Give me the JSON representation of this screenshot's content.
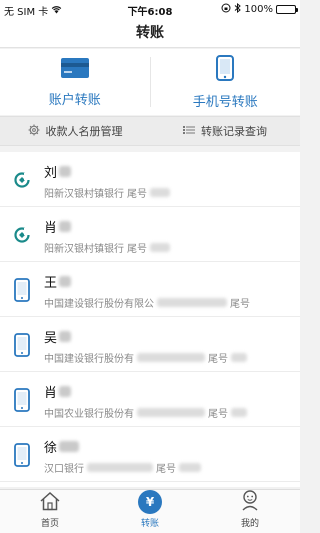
{
  "status_bar": {
    "carrier": "无 SIM 卡",
    "time": "下午6:08",
    "battery": "100%",
    "battery_level": 1.0
  },
  "nav": {
    "title": "转账"
  },
  "transfer_options": [
    {
      "label": "账户转账",
      "icon": "bank-card-icon"
    },
    {
      "label": "手机号转账",
      "icon": "phone-icon"
    }
  ],
  "sub_actions": [
    {
      "label": "收款人名册管理",
      "icon": "gear-icon"
    },
    {
      "label": "转账记录查询",
      "icon": "list-icon"
    }
  ],
  "payees": [
    {
      "name": "刘",
      "bank": "阳新汉银村镇银行",
      "tail_label": "尾号",
      "icon": "bank-logo-icon"
    },
    {
      "name": "肖",
      "bank": "阳新汉银村镇银行",
      "tail_label": "尾号",
      "icon": "bank-logo-icon"
    },
    {
      "name": "王",
      "bank": "中国建设银行股份有限公",
      "tail_label": "尾号",
      "icon": "phone-icon"
    },
    {
      "name": "吴",
      "bank": "中国建设银行股份有",
      "tail_label": "尾号",
      "icon": "phone-icon"
    },
    {
      "name": "肖",
      "bank": "中国农业银行股份有",
      "tail_label": "尾号",
      "icon": "phone-icon"
    },
    {
      "name": "徐",
      "bank": "汉口银行",
      "tail_label": "尾号",
      "icon": "phone-icon"
    }
  ],
  "tabs": [
    {
      "label": "首页",
      "icon": "home-icon",
      "active": false
    },
    {
      "label": "转账",
      "icon": "yen-icon",
      "active": true,
      "glyph": "¥"
    },
    {
      "label": "我的",
      "icon": "user-icon",
      "active": false
    }
  ],
  "colors": {
    "accent": "#2a78bf",
    "bank_logo": "#1a8a8a"
  }
}
